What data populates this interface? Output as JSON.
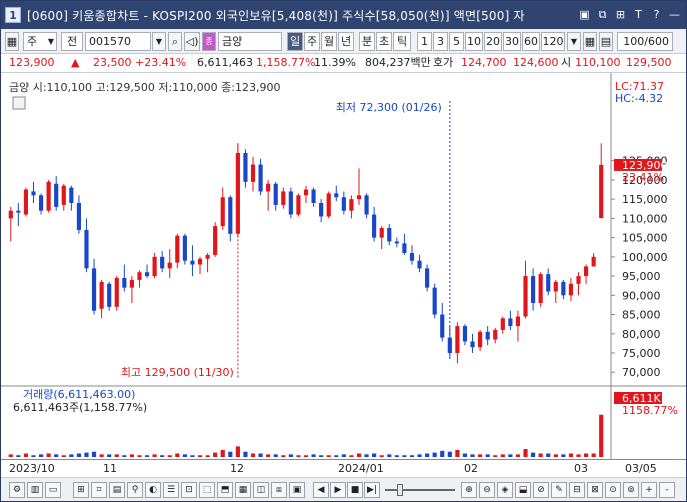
{
  "window": {
    "id_badge": "1",
    "title": "[0600] 키움종합차트 - KOSPI200 외국인보유[5,408(천)] 주식수[58,050(천)] 액면[500] 자",
    "buttons": [
      "▣",
      "⧉",
      "⊞",
      "T",
      "?",
      "—"
    ]
  },
  "toolbar": {
    "period_select": "주",
    "chart_type": "전",
    "code": "001570",
    "stock_name": "금양",
    "name_badge": "종",
    "periods": [
      "일",
      "주",
      "월",
      "년",
      "분",
      "초",
      "틱"
    ],
    "active_period": "일",
    "intervals": [
      "1",
      "3",
      "5",
      "10",
      "20",
      "30",
      "60",
      "120"
    ],
    "count": "100/600"
  },
  "infobar": {
    "price": "123,900",
    "price_arrow": "▲",
    "change": "23,500",
    "change_pct": "+23.41%",
    "volume": "6,611,463",
    "volume_pct": "1,158.77%",
    "turnover": "11.39%",
    "amount": "804,237백만",
    "hoga_label": "호가",
    "ask": "124,700",
    "bid": "124,600",
    "open_label": "시",
    "open": "110,100",
    "high": "129,500"
  },
  "chart_data": {
    "type": "candlestick",
    "name": "금양",
    "legend_line": "금양 시:110,100 고:129,500 저:110,000 종:123,900",
    "ylim": [
      68500,
      140000
    ],
    "yticks": [
      "70,000",
      "75,000",
      "80,000",
      "85,000",
      "90,000",
      "95,000",
      "100,000",
      "105,000",
      "110,000",
      "115,000",
      "120,000",
      "125,000"
    ],
    "current_price_tag": "123,900",
    "current_pct_tag": "23.41%",
    "lc_label": "LC:71.37",
    "hc_label": "HC:-4.32",
    "max_annotation": "최고 129,500 (11/30)",
    "min_annotation": "최저 72,300 (01/26)",
    "max_index": 30,
    "min_index": 58,
    "candles": [
      [
        110000,
        113000,
        104000,
        112000
      ],
      [
        112000,
        114000,
        108000,
        111500
      ],
      [
        111000,
        118000,
        110500,
        117500
      ],
      [
        117000,
        119500,
        114000,
        116000
      ],
      [
        116000,
        116500,
        111000,
        112000
      ],
      [
        112000,
        120000,
        111500,
        119500
      ],
      [
        119000,
        121000,
        112000,
        113000
      ],
      [
        113500,
        119000,
        112000,
        118500
      ],
      [
        118000,
        118500,
        112000,
        114000
      ],
      [
        114000,
        116000,
        106000,
        107000
      ],
      [
        107000,
        110000,
        96000,
        97000
      ],
      [
        97000,
        99500,
        85000,
        86000
      ],
      [
        86500,
        94000,
        84000,
        93500
      ],
      [
        93000,
        93500,
        86000,
        87000
      ],
      [
        87000,
        95000,
        86000,
        94500
      ],
      [
        94500,
        98000,
        91000,
        92000
      ],
      [
        92000,
        95000,
        88000,
        94000
      ],
      [
        94000,
        96500,
        92000,
        96000
      ],
      [
        96000,
        98000,
        94500,
        95000
      ],
      [
        95000,
        101000,
        94500,
        100000
      ],
      [
        100000,
        101500,
        96000,
        97000
      ],
      [
        97000,
        102000,
        94500,
        98500
      ],
      [
        98500,
        106000,
        97000,
        105500
      ],
      [
        105500,
        106000,
        98000,
        99000
      ],
      [
        99000,
        103000,
        95000,
        98000
      ],
      [
        98000,
        100000,
        95500,
        99500
      ],
      [
        99500,
        101000,
        96000,
        100500
      ],
      [
        100500,
        109000,
        100000,
        108000
      ],
      [
        108000,
        118000,
        107000,
        115500
      ],
      [
        115500,
        116000,
        104000,
        106000
      ],
      [
        106000,
        129500,
        105000,
        127000
      ],
      [
        127000,
        128000,
        118000,
        119500
      ],
      [
        119500,
        126000,
        117000,
        124000
      ],
      [
        124000,
        125500,
        116000,
        117000
      ],
      [
        117000,
        120000,
        112000,
        119000
      ],
      [
        119000,
        119500,
        112000,
        113500
      ],
      [
        113500,
        118000,
        112500,
        117000
      ],
      [
        117000,
        118000,
        110000,
        111000
      ],
      [
        111000,
        116500,
        110500,
        116000
      ],
      [
        116000,
        118500,
        114000,
        117500
      ],
      [
        117500,
        118000,
        113000,
        114000
      ],
      [
        114000,
        115000,
        109000,
        110500
      ],
      [
        110500,
        117000,
        110000,
        116500
      ],
      [
        116500,
        118500,
        114500,
        115500
      ],
      [
        115500,
        117000,
        111000,
        112000
      ],
      [
        112000,
        116000,
        110000,
        115000
      ],
      [
        115000,
        123000,
        113500,
        116000
      ],
      [
        116000,
        116500,
        110000,
        111000
      ],
      [
        111000,
        113000,
        104000,
        105000
      ],
      [
        105000,
        108000,
        102000,
        107500
      ],
      [
        107500,
        108500,
        103000,
        104000
      ],
      [
        104000,
        105000,
        102500,
        103500
      ],
      [
        103500,
        106000,
        100500,
        101000
      ],
      [
        101000,
        103000,
        98000,
        99000
      ],
      [
        99000,
        100500,
        96000,
        97000
      ],
      [
        97000,
        98000,
        91000,
        92000
      ],
      [
        92000,
        93000,
        84000,
        85000
      ],
      [
        85000,
        88000,
        78000,
        79000
      ],
      [
        79000,
        82000,
        73500,
        75000
      ],
      [
        75000,
        83000,
        72300,
        82000
      ],
      [
        82000,
        82500,
        77000,
        78000
      ],
      [
        78000,
        80000,
        75000,
        76500
      ],
      [
        76500,
        81000,
        75500,
        80500
      ],
      [
        80500,
        82000,
        77000,
        78500
      ],
      [
        78500,
        81500,
        77500,
        81000
      ],
      [
        81000,
        84500,
        80000,
        84000
      ],
      [
        84000,
        86000,
        81000,
        82000
      ],
      [
        82000,
        86000,
        78000,
        84500
      ],
      [
        84500,
        99000,
        84000,
        95000
      ],
      [
        95000,
        97000,
        86000,
        88000
      ],
      [
        88000,
        96000,
        87000,
        95500
      ],
      [
        95500,
        97000,
        90000,
        91000
      ],
      [
        91000,
        94000,
        88000,
        93500
      ],
      [
        93500,
        94000,
        89000,
        90000
      ],
      [
        90000,
        94500,
        88500,
        93000
      ],
      [
        93000,
        96000,
        90000,
        95000
      ],
      [
        95000,
        98000,
        93000,
        97500
      ],
      [
        97500,
        101000,
        98000,
        100000
      ],
      [
        110100,
        129500,
        110000,
        123900
      ]
    ]
  },
  "volume_data": {
    "type": "bar",
    "legend": "거래량(6,611,463.00)",
    "legend2": "6,611,463주(1,158.77%)",
    "tag1": "6,611K",
    "tag2": "1158.77%",
    "values": [
      3,
      2,
      4,
      2,
      3,
      4,
      3,
      2,
      3,
      4,
      5,
      6,
      3,
      3,
      3,
      2,
      3,
      2,
      2,
      3,
      2,
      2,
      4,
      3,
      2,
      2,
      2,
      5,
      8,
      6,
      12,
      6,
      4,
      4,
      3,
      3,
      2,
      3,
      2,
      2,
      3,
      2,
      2,
      2,
      3,
      2,
      4,
      3,
      4,
      2,
      3,
      2,
      2,
      2,
      3,
      4,
      5,
      7,
      6,
      8,
      4,
      3,
      3,
      3,
      2,
      3,
      3,
      3,
      9,
      5,
      4,
      4,
      3,
      3,
      4,
      3,
      4,
      4,
      48
    ],
    "ymax": 50
  },
  "date_axis": {
    "labels": [
      "2023/10",
      "11",
      "12",
      "2024/01",
      "02",
      "03",
      "03/05"
    ]
  },
  "bottombar": {
    "buttons": [
      "◀",
      "▶",
      "|◀",
      "■",
      "▶|",
      "+",
      "-"
    ]
  },
  "colors": {
    "up": "#e0161b",
    "down": "#1848c8",
    "title_bg": "#2f4470",
    "price_tag_bg": "#e0161b"
  }
}
